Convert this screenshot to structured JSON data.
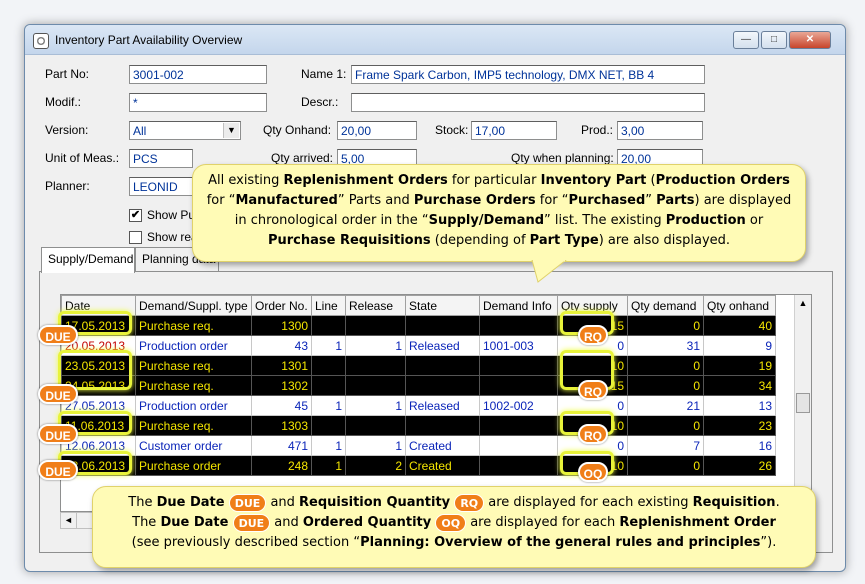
{
  "window": {
    "title": "Inventory Part Availability Overview",
    "controls": {
      "minimize": "—",
      "maximize": "□",
      "close": "✕"
    }
  },
  "form": {
    "part_no": {
      "label": "Part No:",
      "value": "3001-002"
    },
    "name1": {
      "label": "Name 1:",
      "value": "Frame Spark Carbon, IMP5 technology, DMX NET, BB 4"
    },
    "modif": {
      "label": "Modif.:",
      "value": "*"
    },
    "descr": {
      "label": "Descr.:",
      "value": ""
    },
    "version": {
      "label": "Version:",
      "value": "All"
    },
    "qty_onhand": {
      "label": "Qty Onhand:",
      "value": "20,00"
    },
    "stock": {
      "label": "Stock:",
      "value": "17,00"
    },
    "prod": {
      "label": "Prod.:",
      "value": "3,00"
    },
    "unit": {
      "label": "Unit of Meas.:",
      "value": "PCS"
    },
    "qty_arrived": {
      "label": "Qty arrived:",
      "value": "5,00"
    },
    "qty_planning": {
      "label": "Qty when planning:",
      "value": "20,00"
    },
    "planner": {
      "label": "Planner:",
      "value": "LEONID"
    },
    "show_pu": {
      "label": "Show Pu",
      "checked": "✔"
    },
    "show_re": {
      "label": "Show rea"
    }
  },
  "tabs": [
    {
      "label": "Supply/Demand"
    },
    {
      "label": "Planning data"
    }
  ],
  "grid": {
    "columns": [
      "Date",
      "Demand/Suppl. type",
      "Order No.",
      "Line",
      "Release",
      "State",
      "Demand Info",
      "Qty supply",
      "Qty demand",
      "Qty onhand"
    ],
    "rows": [
      {
        "style": "dark",
        "date": "17.05.2013",
        "type": "Purchase req.",
        "order": "1300",
        "line": "",
        "release": "",
        "state": "",
        "info": "",
        "supply": "15",
        "demand": "0",
        "onhand": "40"
      },
      {
        "style": "light",
        "date": "20.05.2013",
        "date_red": true,
        "type": "Production order",
        "order": "43",
        "line": "1",
        "release": "1",
        "state": "Released",
        "info": "1001-003",
        "supply": "0",
        "demand": "31",
        "onhand": "9"
      },
      {
        "style": "dark",
        "date": "23.05.2013",
        "type": "Purchase req.",
        "order": "1301",
        "line": "",
        "release": "",
        "state": "",
        "info": "",
        "supply": "10",
        "demand": "0",
        "onhand": "19"
      },
      {
        "style": "dark",
        "date": "24.05.2013",
        "type": "Purchase req.",
        "order": "1302",
        "line": "",
        "release": "",
        "state": "",
        "info": "",
        "supply": "15",
        "demand": "0",
        "onhand": "34"
      },
      {
        "style": "light",
        "date": "27.05.2013",
        "type": "Production order",
        "order": "45",
        "line": "1",
        "release": "1",
        "state": "Released",
        "info": "1002-002",
        "supply": "0",
        "demand": "21",
        "onhand": "13"
      },
      {
        "style": "dark",
        "date": "11.06.2013",
        "type": "Purchase req.",
        "order": "1303",
        "line": "",
        "release": "",
        "state": "",
        "info": "",
        "supply": "10",
        "demand": "0",
        "onhand": "23"
      },
      {
        "style": "light",
        "date": "12.06.2013",
        "type": "Customer order",
        "order": "471",
        "line": "1",
        "release": "1",
        "state": "Created",
        "info": "",
        "supply": "0",
        "demand": "7",
        "onhand": "16"
      },
      {
        "style": "dark",
        "date": "18.06.2013",
        "type": "Purchase order",
        "order": "248",
        "line": "1",
        "release": "2",
        "state": "Created",
        "info": "",
        "supply": "10",
        "demand": "0",
        "onhand": "26"
      }
    ]
  },
  "badges": {
    "due": "DUE",
    "rq": "RQ",
    "oq": "OQ"
  },
  "callout_top": {
    "p1": "All existing ",
    "b1": "Replenishment Orders",
    "p2": " for particular ",
    "b2": "Inventory Part",
    "p3": " (",
    "b3": "Production Orders",
    "p4": " for “",
    "b4": "Manufactured",
    "p5": "” Parts and ",
    "b5": "Purchase Orders",
    "p6": " for “",
    "b6": "Purchased",
    "p7": "” ",
    "b7": "Parts",
    "p8": ") are displayed in chronological order in the “",
    "b8": "Supply/Demand",
    "p9": "” list.  The existing ",
    "b9": "Production",
    "p10": " or ",
    "b10": "Purchase Requisitions",
    "p11": " (depending of ",
    "b11": "Part Type",
    "p12": ") are also displayed."
  },
  "callout_bottom": {
    "l1a": "The ",
    "l1b": "Due Date",
    "l1c": " and ",
    "l1d": "Requisition Quantity",
    "l1e": " are displayed for each existing ",
    "l1f": "Requisition",
    "l1g": ".",
    "l2a": "The ",
    "l2b": "Due Date",
    "l2c": " and ",
    "l2d": "Ordered Quantity",
    "l2e": " are displayed for each ",
    "l2f": "Replenishment Order",
    "l3a": "(see previously described section “",
    "l3b": "Planning:  Overview of the general rules and principles",
    "l3c": "”)."
  },
  "colors": {
    "badge": "#f07e18",
    "highlight": "#e8f33a",
    "callout": "#fffbb6",
    "dark_row_text": "#f5e600",
    "light_row_text": "#0a24b8",
    "late_date": "#c00000"
  }
}
